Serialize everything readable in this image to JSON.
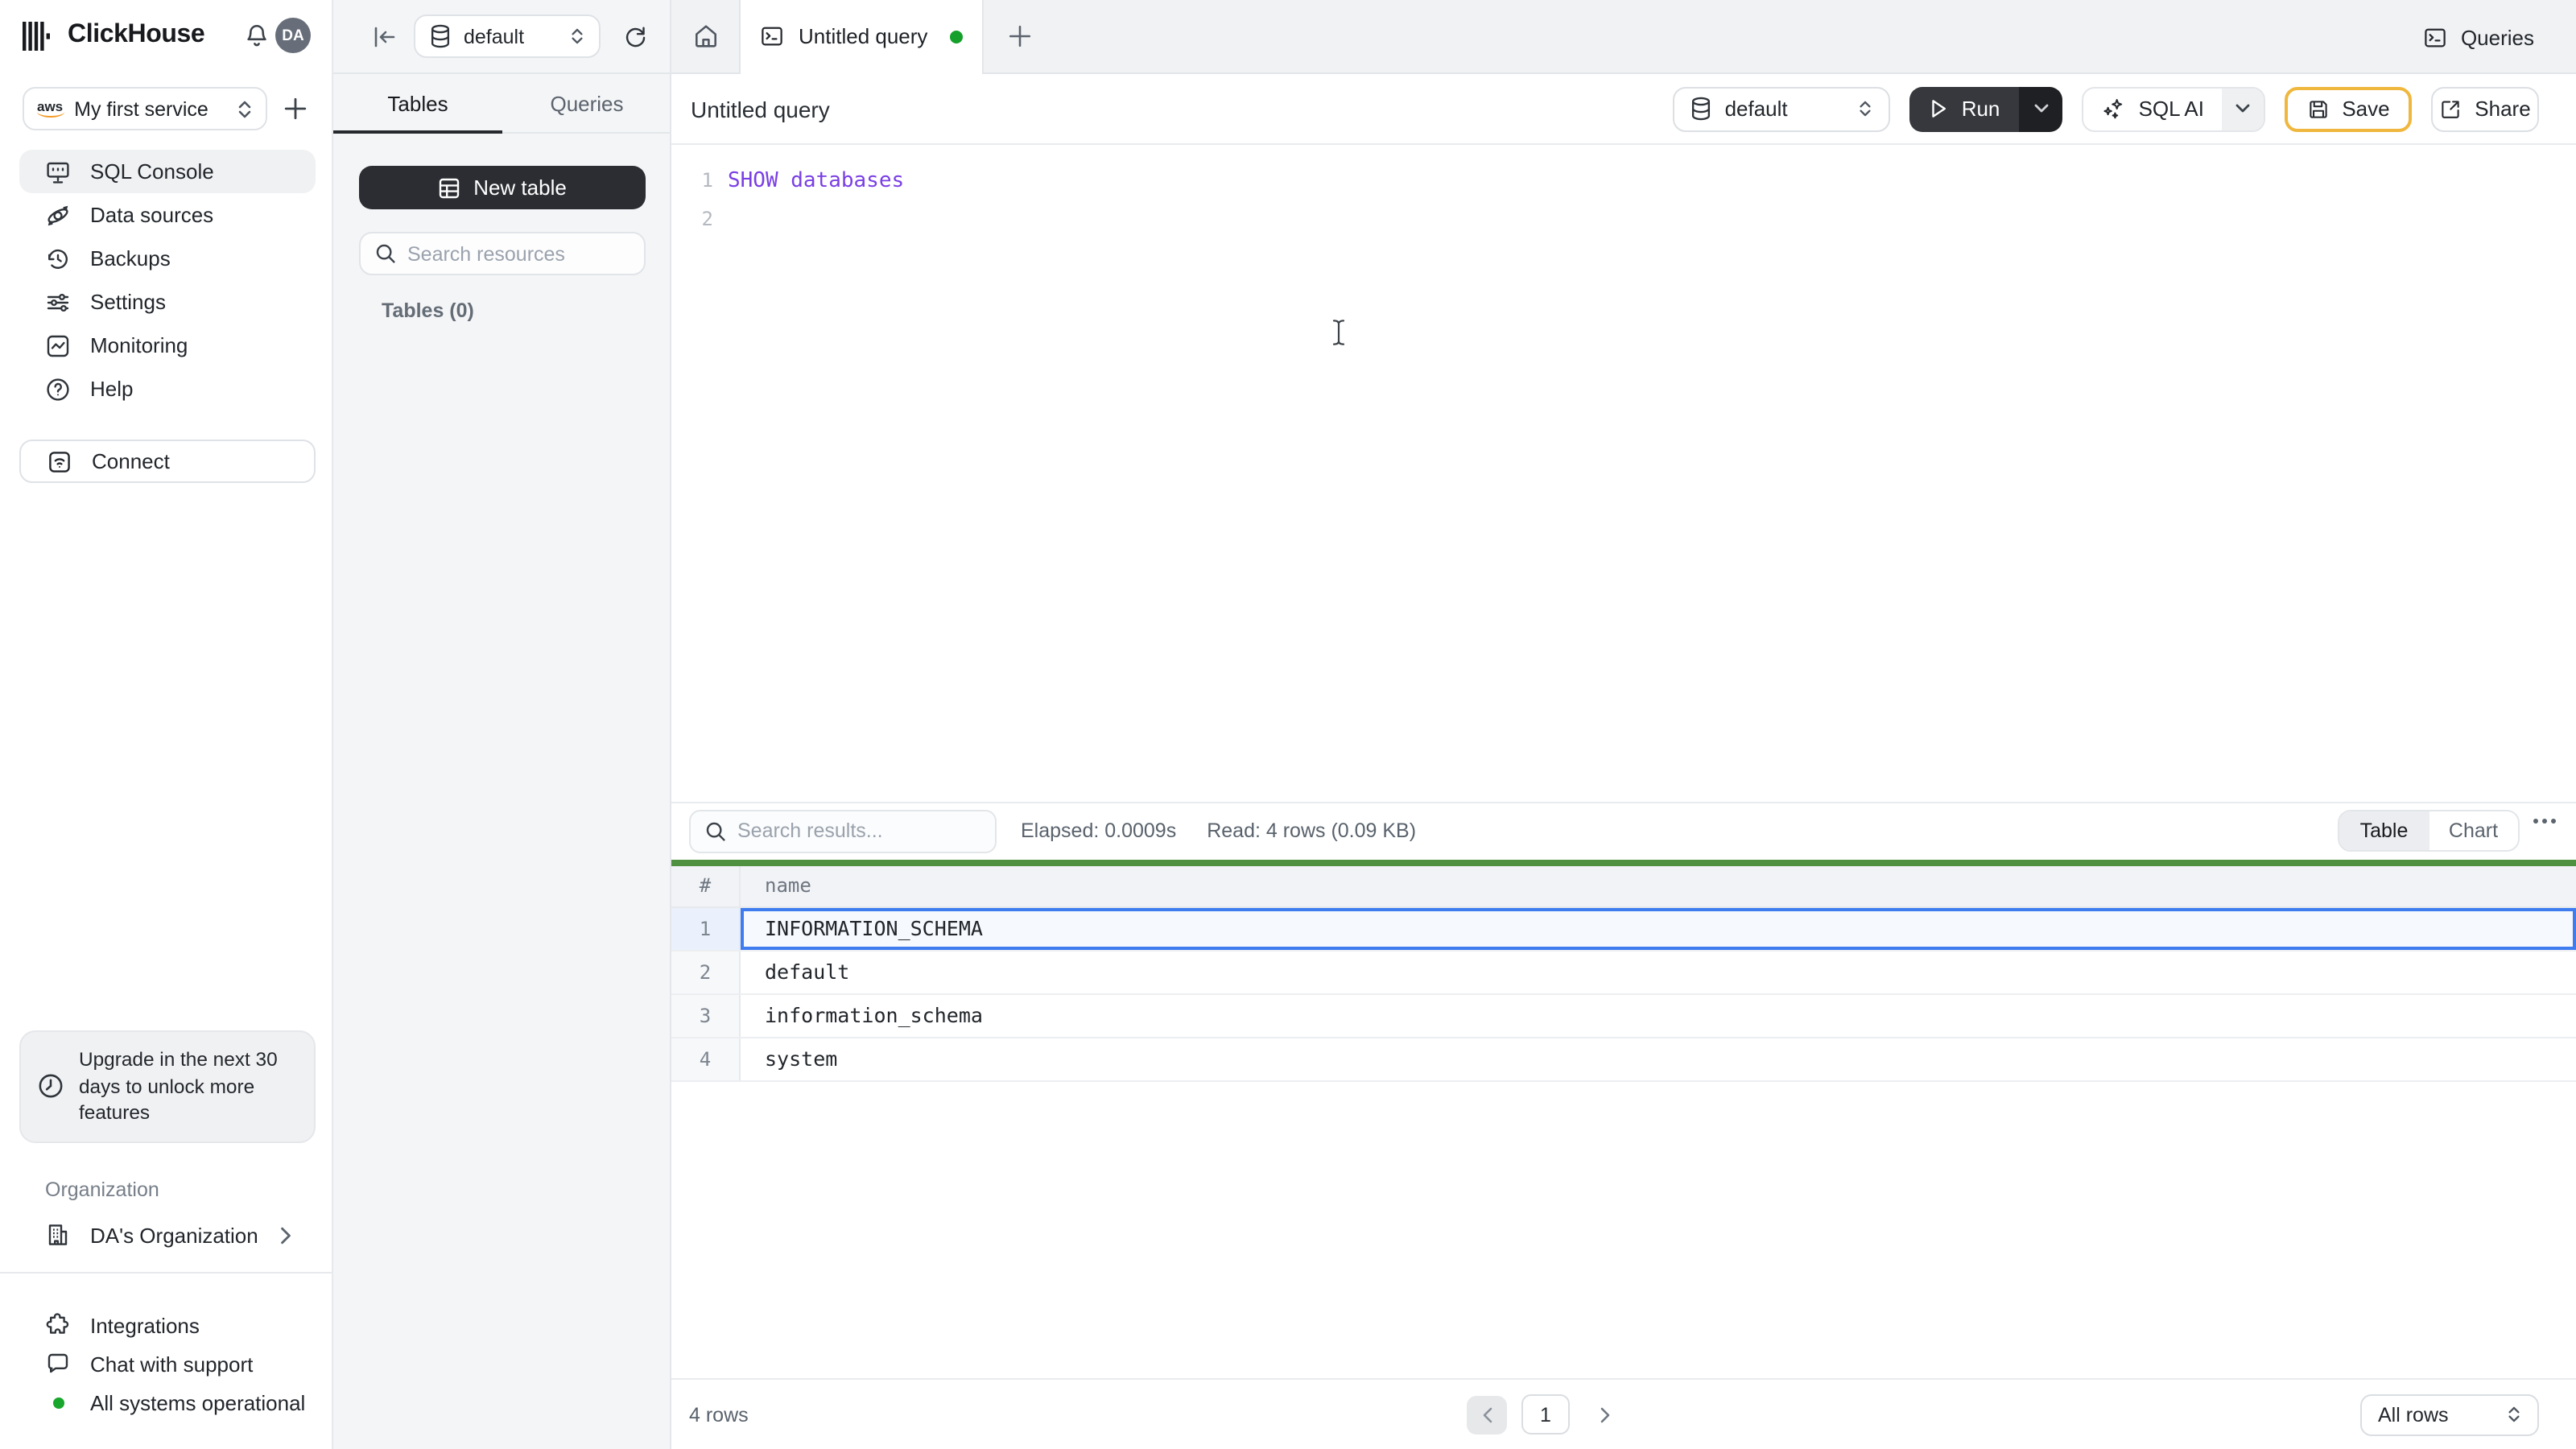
{
  "header": {
    "brand": "ClickHouse",
    "avatar_initials": "DA",
    "queries_button": "Queries"
  },
  "service": {
    "provider_label": "aws",
    "name": "My first service"
  },
  "sidebar": {
    "items": [
      {
        "label": "SQL Console"
      },
      {
        "label": "Data sources"
      },
      {
        "label": "Backups"
      },
      {
        "label": "Settings"
      },
      {
        "label": "Monitoring"
      },
      {
        "label": "Help"
      }
    ],
    "connect_label": "Connect",
    "upgrade_notice": "Upgrade in the next 30 days to unlock more features",
    "organization_section": "Organization",
    "organization_name": "DA's Organization",
    "integrations_label": "Integrations",
    "chat_label": "Chat with support",
    "status_label": "All systems operational"
  },
  "explorer": {
    "database": "default",
    "tabs": [
      {
        "label": "Tables"
      },
      {
        "label": "Queries"
      }
    ],
    "new_table_label": "New table",
    "search_placeholder": "Search resources",
    "tables_count": "Tables (0)"
  },
  "tab_bar": {
    "active_tab": "Untitled query"
  },
  "query": {
    "title": "Untitled query",
    "database": "default",
    "run_label": "Run",
    "sql_ai_label": "SQL AI",
    "save_label": "Save",
    "share_label": "Share",
    "lines": [
      {
        "n": "1",
        "code": "SHOW databases"
      },
      {
        "n": "2",
        "code": ""
      }
    ]
  },
  "results": {
    "search_placeholder": "Search results...",
    "elapsed": "Elapsed: 0.0009s",
    "read": "Read: 4 rows (0.09 KB)",
    "views": [
      {
        "label": "Table"
      },
      {
        "label": "Chart"
      }
    ],
    "columns": {
      "index": "#",
      "name": "name"
    },
    "rows": [
      {
        "n": "1",
        "name": "INFORMATION_SCHEMA"
      },
      {
        "n": "2",
        "name": "default"
      },
      {
        "n": "3",
        "name": "information_schema"
      },
      {
        "n": "4",
        "name": "system"
      }
    ],
    "total": "4 rows",
    "page": "1",
    "page_size": "All rows"
  },
  "colors": {
    "accent_green_bar": "#4f9140",
    "status_green": "#18a62c",
    "selection_blue": "#3e7cf0",
    "save_border": "#f0b73e",
    "code_keyword": "#7a3fe4"
  }
}
